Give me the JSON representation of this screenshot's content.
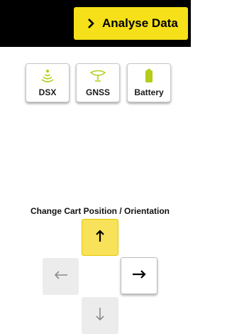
{
  "header": {
    "analyse_label": "Analyse Data",
    "analyse_icon": "chevron-right-icon"
  },
  "status": {
    "items": [
      {
        "label": "DSX",
        "icon": "signal-waves-icon",
        "color": "#b5cc18"
      },
      {
        "label": "GNSS",
        "icon": "satellite-antenna-icon",
        "color": "#b5cc18"
      },
      {
        "label": "Battery",
        "icon": "battery-icon",
        "color": "#b5cc18"
      }
    ]
  },
  "control": {
    "caption": "Change Cart Position / Orientation",
    "buttons": [
      {
        "name": "up",
        "icon": "arrow-up-icon",
        "state": "active"
      },
      {
        "name": "left",
        "icon": "arrow-left-icon",
        "state": "disabled"
      },
      {
        "name": "right",
        "icon": "arrow-right-icon",
        "state": "enabled"
      },
      {
        "name": "down",
        "icon": "arrow-down-icon",
        "state": "disabled"
      }
    ]
  },
  "colors": {
    "accent": "#f5e019",
    "status_ok": "#b5cc18",
    "topbar": "#000000",
    "disabled_bg": "#ececec"
  }
}
